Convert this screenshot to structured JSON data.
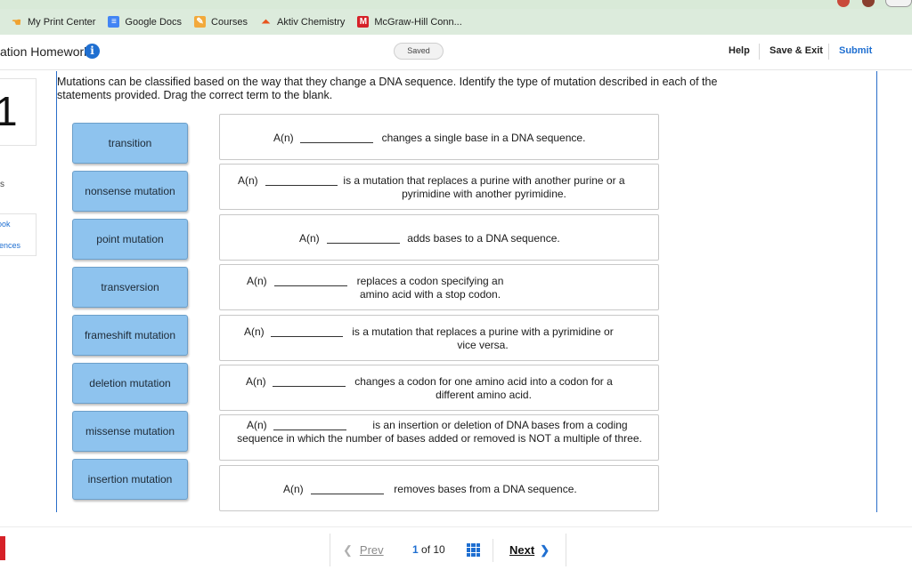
{
  "bookmarks": [
    {
      "label": "My Print Center",
      "icon": "hand-icon",
      "color": "#f0a230"
    },
    {
      "label": "Google Docs",
      "icon": "google-docs-icon",
      "color": "#4285f4"
    },
    {
      "label": "Courses",
      "icon": "courses-icon",
      "color": "#f2a93b"
    },
    {
      "label": "Aktiv Chemistry",
      "icon": "aktiv-icon",
      "color": "#e8541e"
    },
    {
      "label": "McGraw-Hill Conn...",
      "icon": "mcgraw-hill-icon",
      "color": "#d62128"
    }
  ],
  "header": {
    "title": "ation Homework",
    "saved": "Saved",
    "help": "Help",
    "save_exit": "Save & Exit",
    "submit": "Submit"
  },
  "rail": {
    "question_number": "1",
    "mark": "s",
    "link1": "Book",
    "link2": "erences"
  },
  "question": {
    "prompt": "Mutations can be classified based on the way that they change a DNA sequence. Identify the type of mutation described in each of the statements provided. Drag the correct term to the blank."
  },
  "terms": [
    "transition",
    "nonsense mutation",
    "point mutation",
    "transversion",
    "frameshift mutation",
    "deletion mutation",
    "missense mutation",
    "insertion mutation"
  ],
  "statements": [
    {
      "prefix": "A(n)",
      "text": "changes a single base in a DNA sequence."
    },
    {
      "prefix": "A(n)",
      "text": "is a mutation that replaces a purine with another purine or a pyrimidine with another pyrimidine."
    },
    {
      "prefix": "A(n)",
      "text": "adds bases to a DNA sequence."
    },
    {
      "prefix": "A(n)",
      "text": "replaces a codon specifying an amino acid with a stop codon."
    },
    {
      "prefix": "A(n)",
      "text": "is a mutation that replaces a purine with a pyrimidine or vice versa."
    },
    {
      "prefix": "A(n)",
      "text": "changes a codon for one amino acid into a codon for a different amino acid."
    },
    {
      "prefix": "A(n)",
      "text": "is an insertion or deletion of DNA bases from a coding sequence in which the number of bases added or removed is NOT a multiple of three."
    },
    {
      "prefix": "A(n)",
      "text": "removes bases from a DNA sequence."
    }
  ],
  "footer": {
    "prev": "Prev",
    "page_current": "1",
    "page_of": "of 10",
    "next": "Next"
  },
  "colors": {
    "accent": "#1f6fd1",
    "term_bg": "#8ec3ee",
    "bookmark_bar": "#dcebdc"
  }
}
